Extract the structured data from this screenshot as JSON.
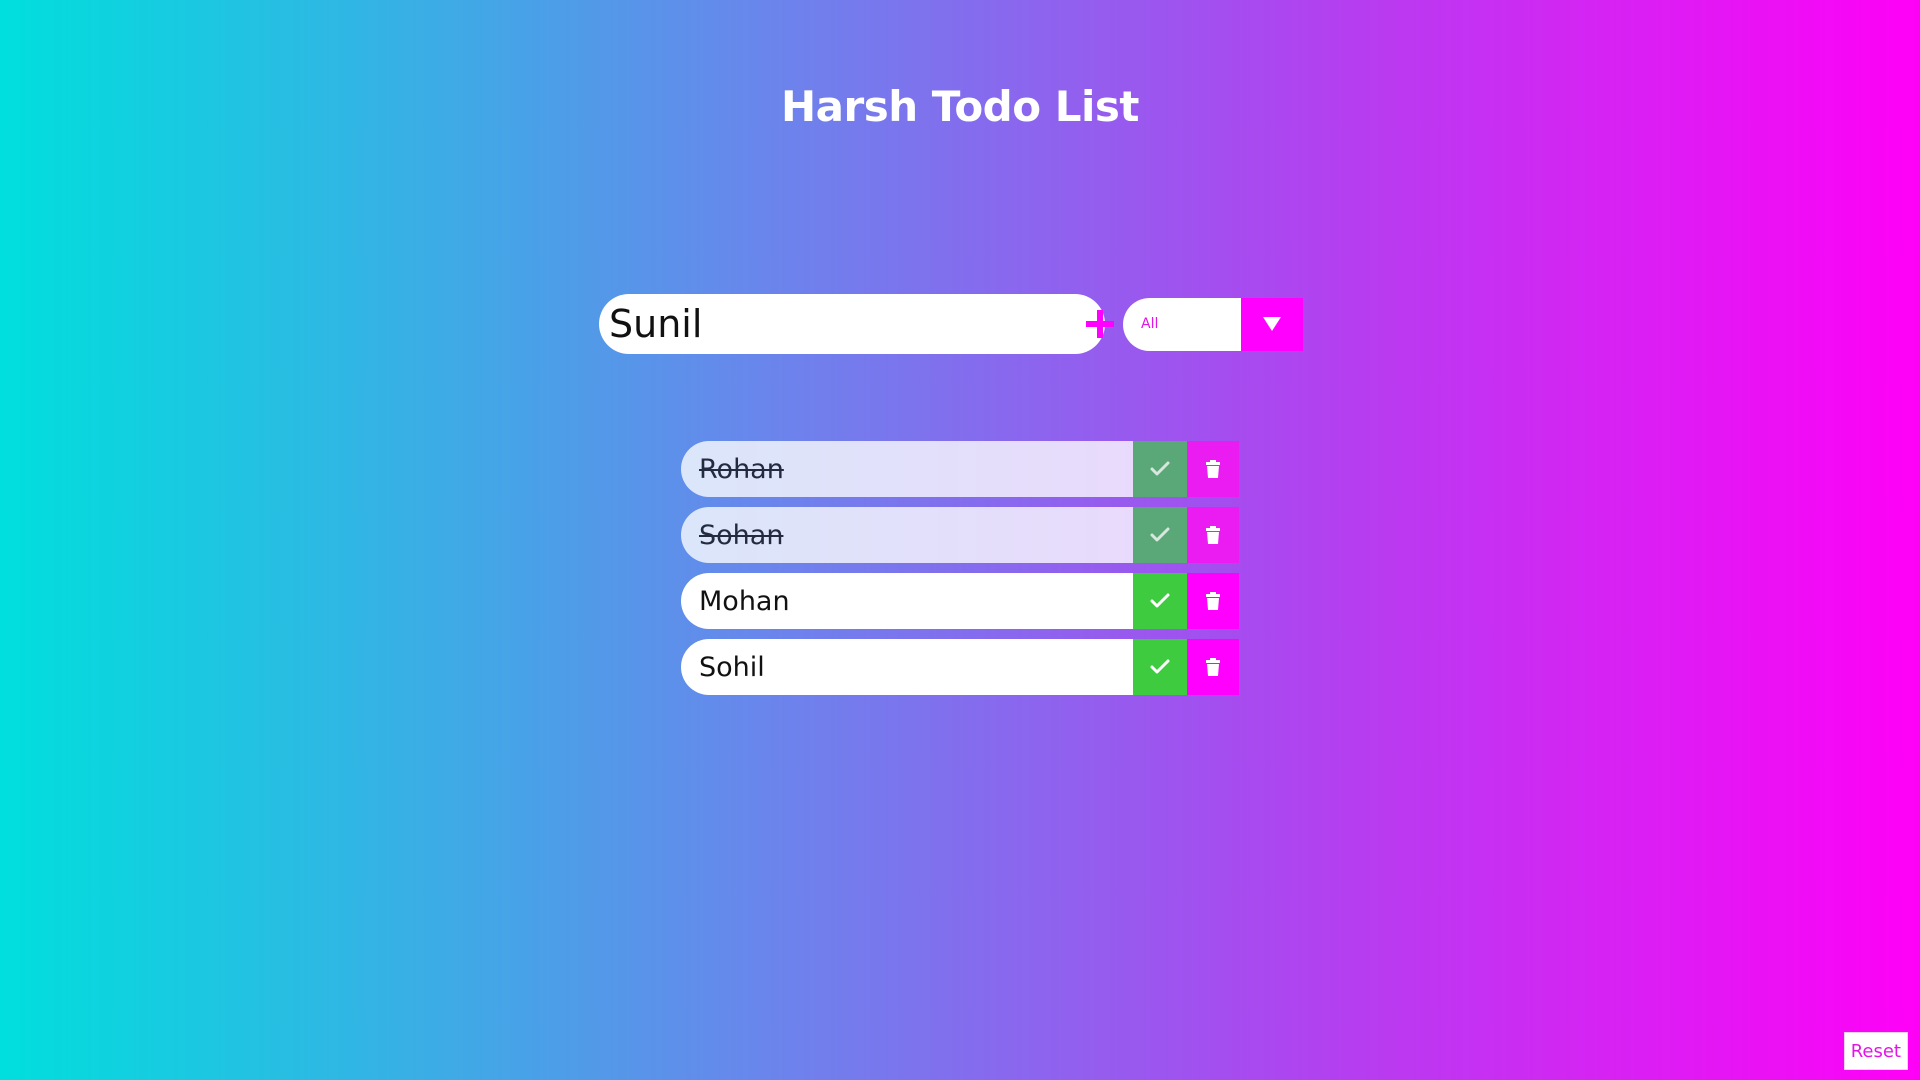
{
  "app": {
    "title": "Harsh Todo List"
  },
  "form": {
    "input_value": "Sunil",
    "add_icon": "plus-icon",
    "filter": {
      "selected": "All",
      "arrow_icon": "caret-down-icon"
    }
  },
  "todos": [
    {
      "text": "Rohan",
      "completed": true
    },
    {
      "text": "Sohan",
      "completed": true
    },
    {
      "text": "Mohan",
      "completed": false
    },
    {
      "text": "Sohil",
      "completed": false
    }
  ],
  "footer": {
    "reset_label": "Reset"
  },
  "colors": {
    "accent": "#ff00ff",
    "success": "#3fcb3f",
    "background_start": "#00dfdd",
    "background_end": "#ff00f7"
  },
  "icons": {
    "complete": "check-icon",
    "delete": "trash-icon"
  }
}
